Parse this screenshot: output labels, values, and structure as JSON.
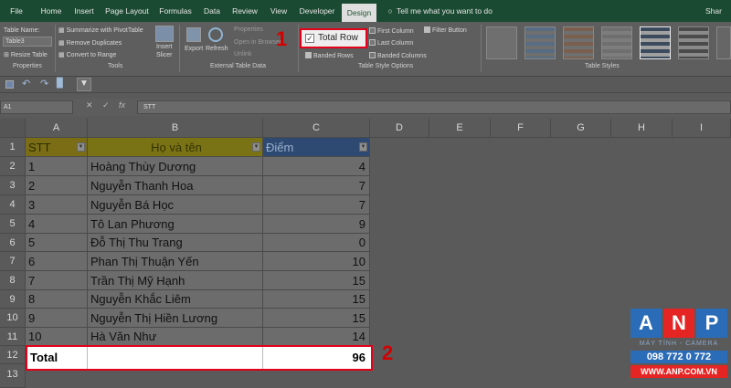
{
  "menu": {
    "tabs": [
      "File",
      "Home",
      "Insert",
      "Page Layout",
      "Formulas",
      "Data",
      "Review",
      "View",
      "Developer",
      "Design"
    ],
    "tell_me": "Tell me what you want to do",
    "share": "Shar"
  },
  "ribbon": {
    "table_name_label": "Table Name:",
    "table_name_value": "Table3",
    "resize_table": "Resize Table",
    "group_properties": "Properties",
    "tools": [
      "Summarize with PivotTable",
      "Remove Duplicates",
      "Convert to Range"
    ],
    "insert_slicer": [
      "Insert",
      "Slicer"
    ],
    "group_tools": "Tools",
    "export": "Export",
    "refresh": "Refresh",
    "ext_items": [
      "Properties",
      "Open in Browser",
      "Unlink"
    ],
    "group_external": "External Table Data",
    "header_row": "Header Row",
    "total_row": "Total Row",
    "banded_rows": "Banded Rows",
    "first_column": "First Column",
    "last_column": "Last Column",
    "banded_columns": "Banded Columns",
    "filter_button": "Filter Button",
    "group_style_options": "Table Style Options",
    "group_styles": "Table Styles"
  },
  "formula_bar": {
    "name_box": "A1",
    "content": "STT"
  },
  "columns": [
    "A",
    "B",
    "C",
    "D",
    "E",
    "F",
    "G",
    "H",
    "I"
  ],
  "rows": [
    "1",
    "2",
    "3",
    "4",
    "5",
    "6",
    "7",
    "8",
    "9",
    "10",
    "11",
    "12",
    "13"
  ],
  "table": {
    "headers": [
      "STT",
      "Họ và tên",
      "Điểm"
    ],
    "data": [
      [
        "1",
        "Hoàng Thùy Dương",
        "4"
      ],
      [
        "2",
        "Nguyễn Thanh Hoa",
        "7"
      ],
      [
        "3",
        "Nguyễn Bá Học",
        "7"
      ],
      [
        "4",
        "Tô Lan Phương",
        "9"
      ],
      [
        "5",
        "Đỗ Thị Thu Trang",
        "0"
      ],
      [
        "6",
        "Phan Thị Thuận Yến",
        "10"
      ],
      [
        "7",
        "Trần Thị Mỹ Hạnh",
        "15"
      ],
      [
        "8",
        "Nguyễn Khắc Liêm",
        "15"
      ],
      [
        "9",
        "Nguyễn Thị Hiền Lương",
        "15"
      ],
      [
        "10",
        "Hà Văn Như",
        "14"
      ]
    ],
    "total_label": "Total",
    "total_value": "96"
  },
  "annotations": {
    "step1": "1",
    "step2": "2"
  },
  "logo": {
    "letters": [
      "A",
      "N",
      "P"
    ],
    "tagline": "MÁY TÍNH - CAMERA",
    "phone": "098 772 0 772",
    "website": "WWW.ANP.COM.VN"
  },
  "colors": {
    "highlight_red": "#e3001b",
    "excel_green": "#1b4a32",
    "logo_blue": "#2b6cb8",
    "logo_red": "#e52424"
  }
}
